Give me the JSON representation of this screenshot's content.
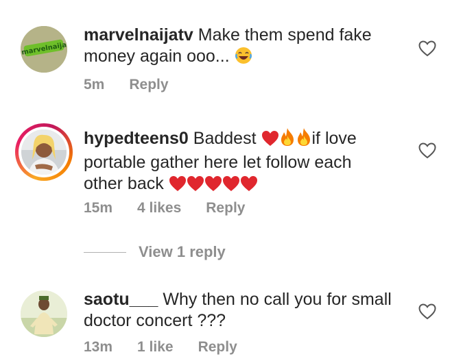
{
  "comments": [
    {
      "username": "marvelnaijatv",
      "text": "Make them spend fake money again ooo...",
      "emoji_icons": [
        "laughing-face-icon"
      ],
      "time": "5m",
      "likes": "",
      "reply_label": "Reply",
      "avatar_logo_text": "marvelnaija"
    },
    {
      "username": "hypedteens0",
      "text_part1": "Baddest",
      "text_part2": "if love portable gather here let follow each other back",
      "emoji_icons": [
        "red-heart-icon",
        "fire-icon",
        "fire-icon",
        "red-heart-icon",
        "red-heart-icon",
        "red-heart-icon",
        "red-heart-icon",
        "red-heart-icon"
      ],
      "time": "15m",
      "likes": "4 likes",
      "reply_label": "Reply"
    },
    {
      "username": "saotu___",
      "text": "Why then no call you for small doctor concert ???",
      "time": "13m",
      "likes": "1 like",
      "reply_label": "Reply"
    }
  ],
  "view_replies_label": "View 1 reply",
  "colors": {
    "text": "#262626",
    "meta": "#8e8e8e",
    "heart_red": "#e0272e",
    "fire_orange": "#f57c00"
  }
}
